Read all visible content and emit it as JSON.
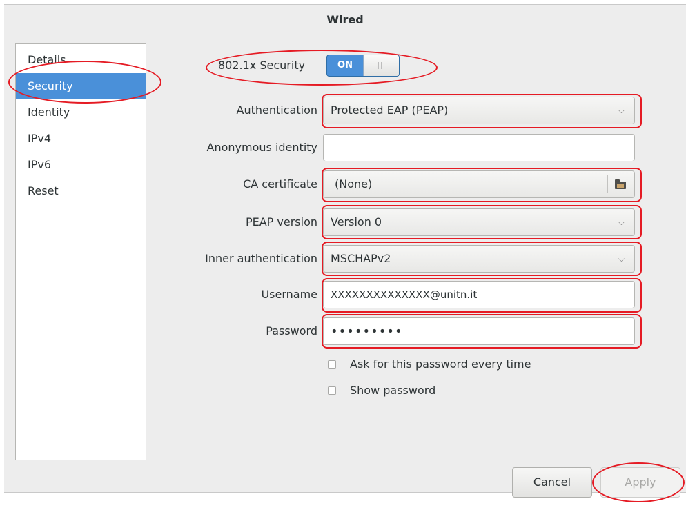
{
  "window": {
    "title": "Wired"
  },
  "sidebar": {
    "items": [
      {
        "label": "Details"
      },
      {
        "label": "Security"
      },
      {
        "label": "Identity"
      },
      {
        "label": "IPv4"
      },
      {
        "label": "IPv6"
      },
      {
        "label": "Reset"
      }
    ],
    "selected": "Security"
  },
  "security": {
    "toggle_label": "802.1x Security",
    "toggle_state": "ON",
    "authentication": {
      "label": "Authentication",
      "value": "Protected EAP (PEAP)"
    },
    "anonymous_identity": {
      "label": "Anonymous identity",
      "value": ""
    },
    "ca_certificate": {
      "label": "CA certificate",
      "value": "(None)"
    },
    "peap_version": {
      "label": "PEAP version",
      "value": "Version 0"
    },
    "inner_authentication": {
      "label": "Inner authentication",
      "value": "MSCHAPv2"
    },
    "username": {
      "label": "Username",
      "value": "XXXXXXXXXXXXXX@unitn.it"
    },
    "password": {
      "label": "Password",
      "value": "•••••••••"
    },
    "ask_password": {
      "label": "Ask for this password every time",
      "checked": false
    },
    "show_password": {
      "label": "Show password",
      "checked": false
    }
  },
  "buttons": {
    "cancel": "Cancel",
    "apply": "Apply"
  },
  "colors": {
    "accent": "#4a90d9",
    "annotation": "#e51b24"
  },
  "icons": {
    "combo_arrow": "chevron-down-icon",
    "file_chooser": "folder-icon"
  }
}
